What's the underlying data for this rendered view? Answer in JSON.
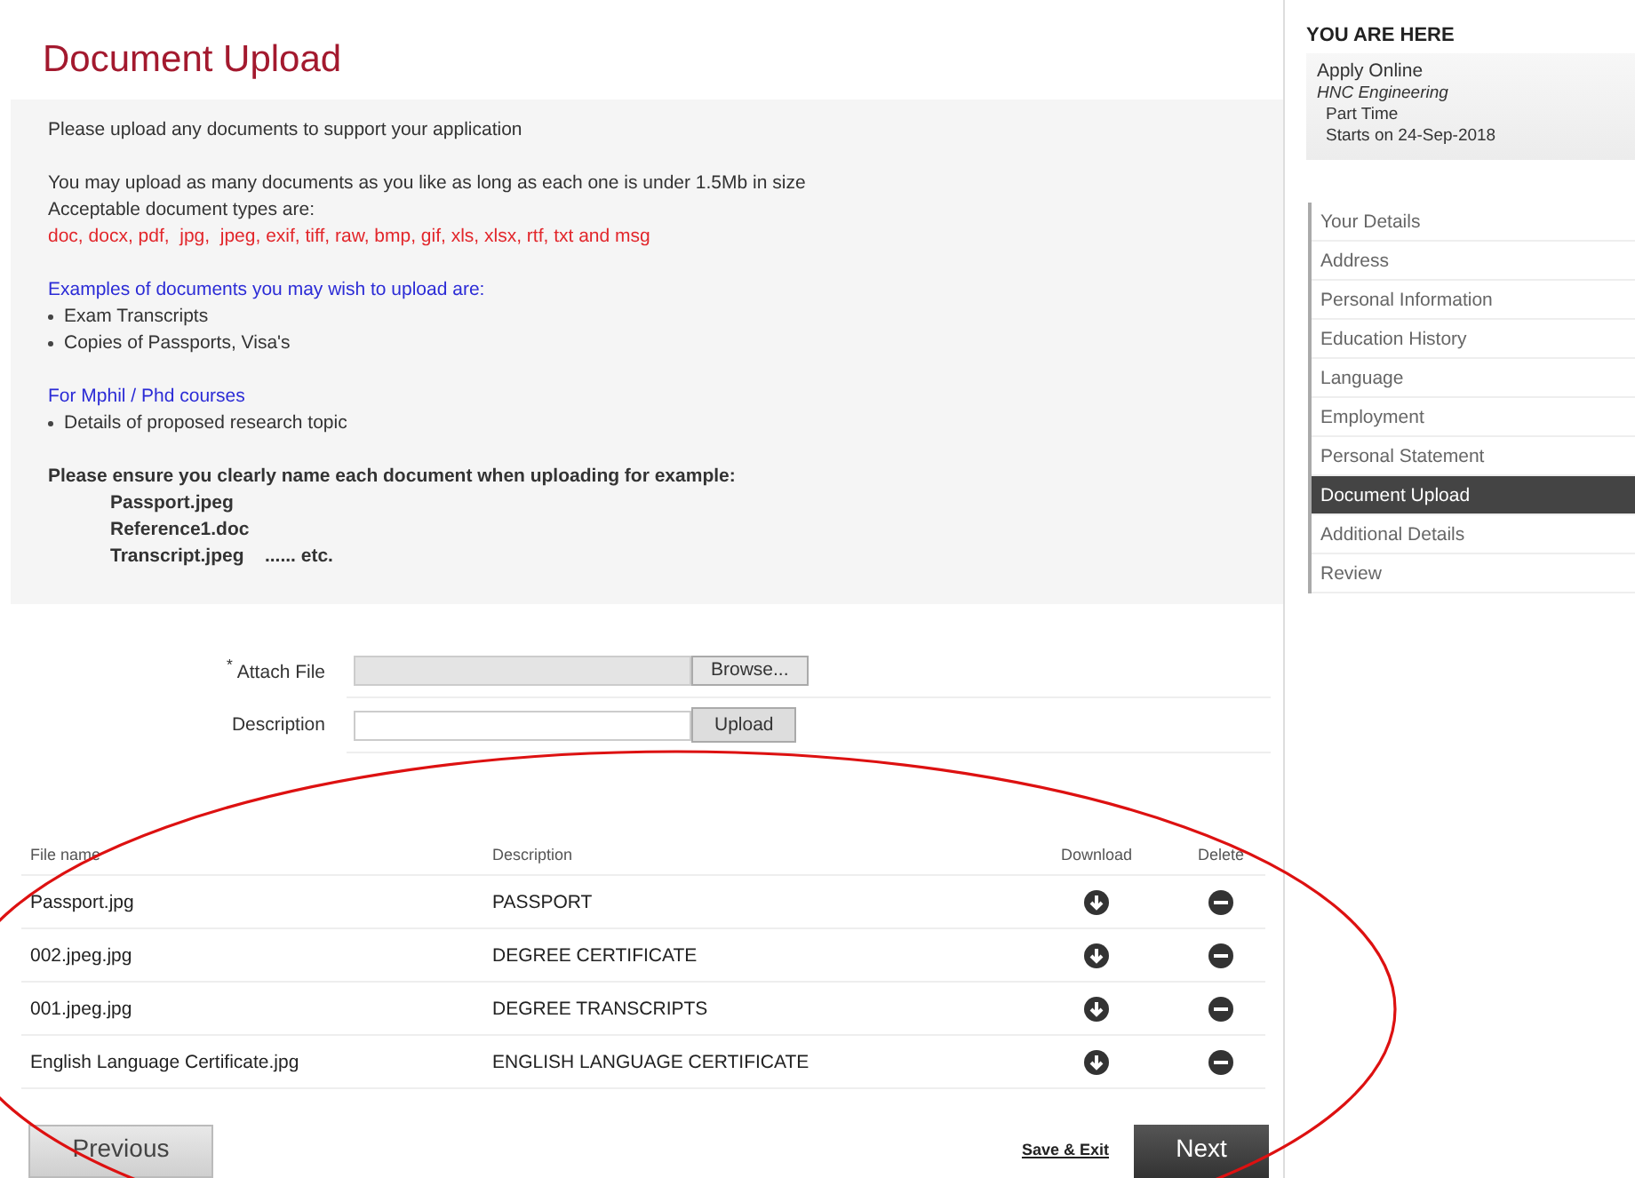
{
  "title": "Document Upload",
  "info": {
    "intro": "Please upload any documents to support your application",
    "size_note": "You may upload as many documents as you like as long as each one is under 1.5Mb in size",
    "types_label": "Acceptable document types are:",
    "types": "doc, docx, pdf,  jpg,  jpeg, exif, tiff, raw, bmp, gif, xls, xlsx, rtf, txt and msg",
    "examples_heading": "Examples of documents you may wish to upload are:",
    "examples": [
      "Exam Transcripts",
      "Copies of Passports, Visa's"
    ],
    "mphil_heading": "For Mphil / Phd courses",
    "mphil": [
      "Details of proposed research topic"
    ],
    "naming_note": "Please ensure you clearly name each document when uploading for example:",
    "naming_examples": [
      "Passport.jpeg",
      "Reference1.doc",
      "Transcript.jpeg    ...... etc."
    ]
  },
  "form": [
    {
      "kind": "file",
      "required_mark": "*",
      "label": "Attach File",
      "button": "Browse..."
    },
    {
      "kind": "text",
      "label": "Description",
      "button": "Upload"
    }
  ],
  "table": {
    "columns": [
      "File name",
      "Description",
      "Download",
      "Delete"
    ],
    "rows": [
      {
        "file": "Passport.jpg",
        "description": "PASSPORT"
      },
      {
        "file": "002.jpeg.jpg",
        "description": "DEGREE CERTIFICATE"
      },
      {
        "file": "001.jpeg.jpg",
        "description": "DEGREE TRANSCRIPTS"
      },
      {
        "file": "English Language Certificate.jpg",
        "description": "ENGLISH LANGUAGE CERTIFICATE"
      }
    ]
  },
  "buttons": {
    "previous": "Previous",
    "save": "Save & Exit",
    "next": "Next"
  },
  "sidebar": {
    "heading": "YOU ARE HERE",
    "breadcrumb": [
      {
        "kind": "plain",
        "text": "Apply Online"
      },
      {
        "kind": "italic",
        "text": "HNC Engineering"
      },
      {
        "kind": "small",
        "text": "Part Time"
      },
      {
        "kind": "small",
        "text": "Starts on 24-Sep-2018"
      }
    ],
    "steps": [
      {
        "label": "Your Details",
        "selected": false
      },
      {
        "label": "Address",
        "selected": false
      },
      {
        "label": "Personal Information",
        "selected": false
      },
      {
        "label": "Education History",
        "selected": false
      },
      {
        "label": "Language",
        "selected": false
      },
      {
        "label": "Employment",
        "selected": false
      },
      {
        "label": "Personal Statement",
        "selected": false
      },
      {
        "label": "Document Upload",
        "selected": true
      },
      {
        "label": "Additional Details",
        "selected": false
      },
      {
        "label": "Review",
        "selected": false
      }
    ]
  }
}
